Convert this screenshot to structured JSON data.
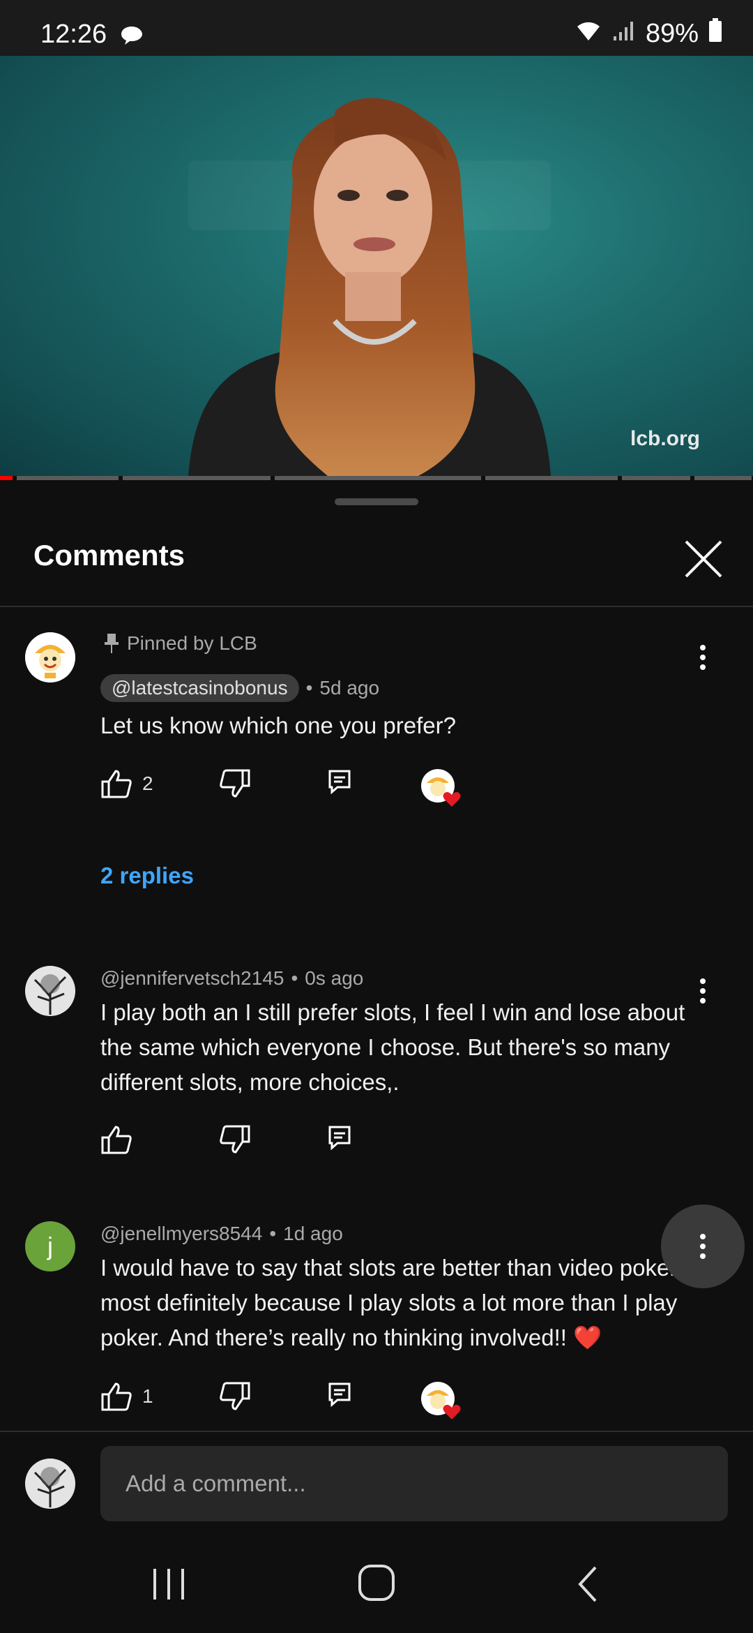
{
  "status": {
    "time": "12:26",
    "battery": "89%"
  },
  "video": {
    "watermark": "lcb.org"
  },
  "sheet": {
    "title": "Comments"
  },
  "comments": [
    {
      "pinned_label": "Pinned by LCB",
      "author": "@latestcasinobonus",
      "age": "5d ago",
      "text": "Let us know which one you prefer?",
      "likes": "2",
      "replies": "2 replies"
    },
    {
      "author": "@jennifervetsch2145",
      "age": "0s ago",
      "text": "I play both an I still prefer slots, I feel I win and lose about the same which everyone I choose. But there's so many different slots, more choices,."
    },
    {
      "avatar_letter": "j",
      "author": "@jenellmyers8544",
      "age": "1d ago",
      "text": "I would have to say that slots are better than video poker most definitely because I play slots a lot more than I play poker. And there’s really no thinking involved!! ❤️",
      "likes": "1"
    }
  ],
  "composer": {
    "placeholder": "Add a comment..."
  },
  "colors": {
    "accent_link": "#3ea6ff",
    "green_avatar": "#6aa33a"
  }
}
